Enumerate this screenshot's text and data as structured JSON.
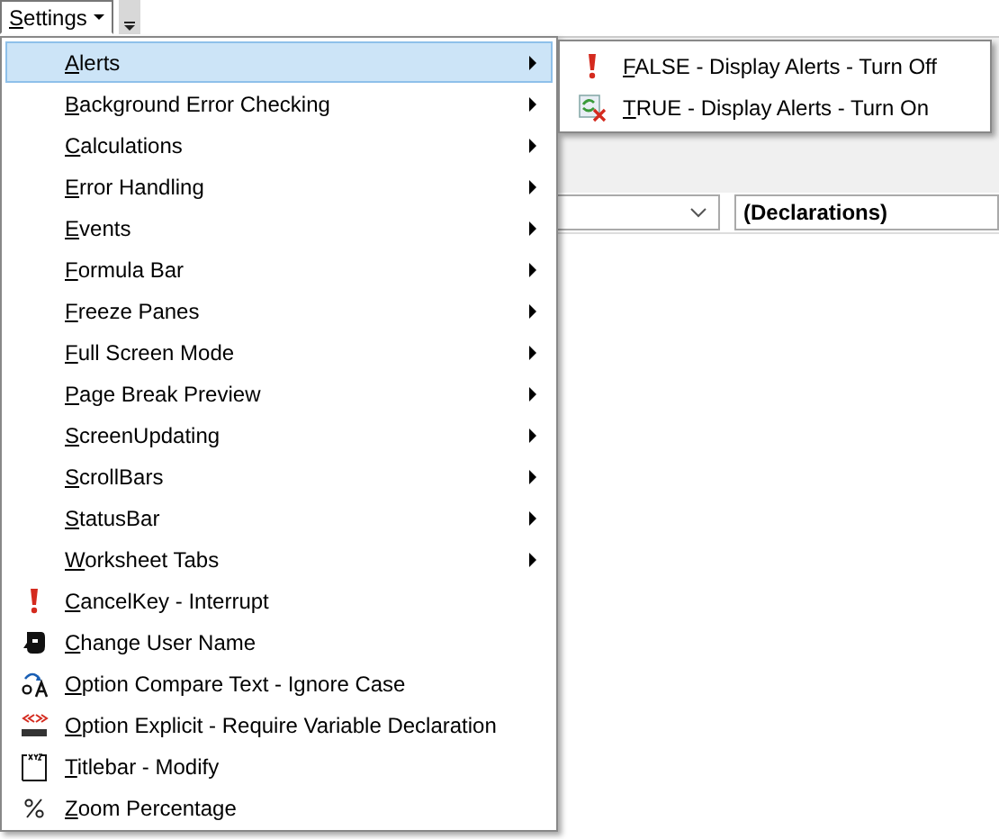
{
  "toolbar": {
    "menu_button": {
      "label": "Settings",
      "expanded": true
    }
  },
  "menu": {
    "items": [
      {
        "label": "Alerts",
        "kind": "submenu",
        "selected": true
      },
      {
        "label": "Background Error Checking",
        "kind": "submenu",
        "selected": false
      },
      {
        "label": "Calculations",
        "kind": "submenu",
        "selected": false
      },
      {
        "label": "Error Handling",
        "kind": "submenu",
        "selected": false
      },
      {
        "label": "Events",
        "kind": "submenu",
        "selected": false
      },
      {
        "label": "Formula Bar",
        "kind": "submenu",
        "selected": false
      },
      {
        "label": "Freeze Panes",
        "kind": "submenu",
        "selected": false
      },
      {
        "label": "Full Screen Mode",
        "kind": "submenu",
        "selected": false
      },
      {
        "label": "Page Break Preview",
        "kind": "submenu",
        "selected": false
      },
      {
        "label": "ScreenUpdating",
        "kind": "submenu",
        "selected": false
      },
      {
        "label": "ScrollBars",
        "kind": "submenu",
        "selected": false
      },
      {
        "label": "StatusBar",
        "kind": "submenu",
        "selected": false
      },
      {
        "label": "Worksheet Tabs",
        "kind": "submenu",
        "selected": false
      },
      {
        "label": "CancelKey - Interrupt",
        "kind": "command",
        "selected": false
      },
      {
        "label": "Change User Name",
        "kind": "command",
        "selected": false
      },
      {
        "label": "Option Compare Text - Ignore Case",
        "kind": "command",
        "selected": false
      },
      {
        "label": "Option Explicit - Require Variable Declaration",
        "kind": "command",
        "selected": false
      },
      {
        "label": "Titlebar - Modify",
        "kind": "command",
        "selected": false
      },
      {
        "label": "Zoom Percentage",
        "kind": "command",
        "selected": false
      }
    ]
  },
  "submenu": {
    "items": [
      {
        "label": "FALSE - Display Alerts - Turn Off"
      },
      {
        "label": "TRUE - Display Alerts - Turn On"
      }
    ]
  },
  "code_pane": {
    "procedure_box": {
      "value": "(Declarations)"
    }
  }
}
